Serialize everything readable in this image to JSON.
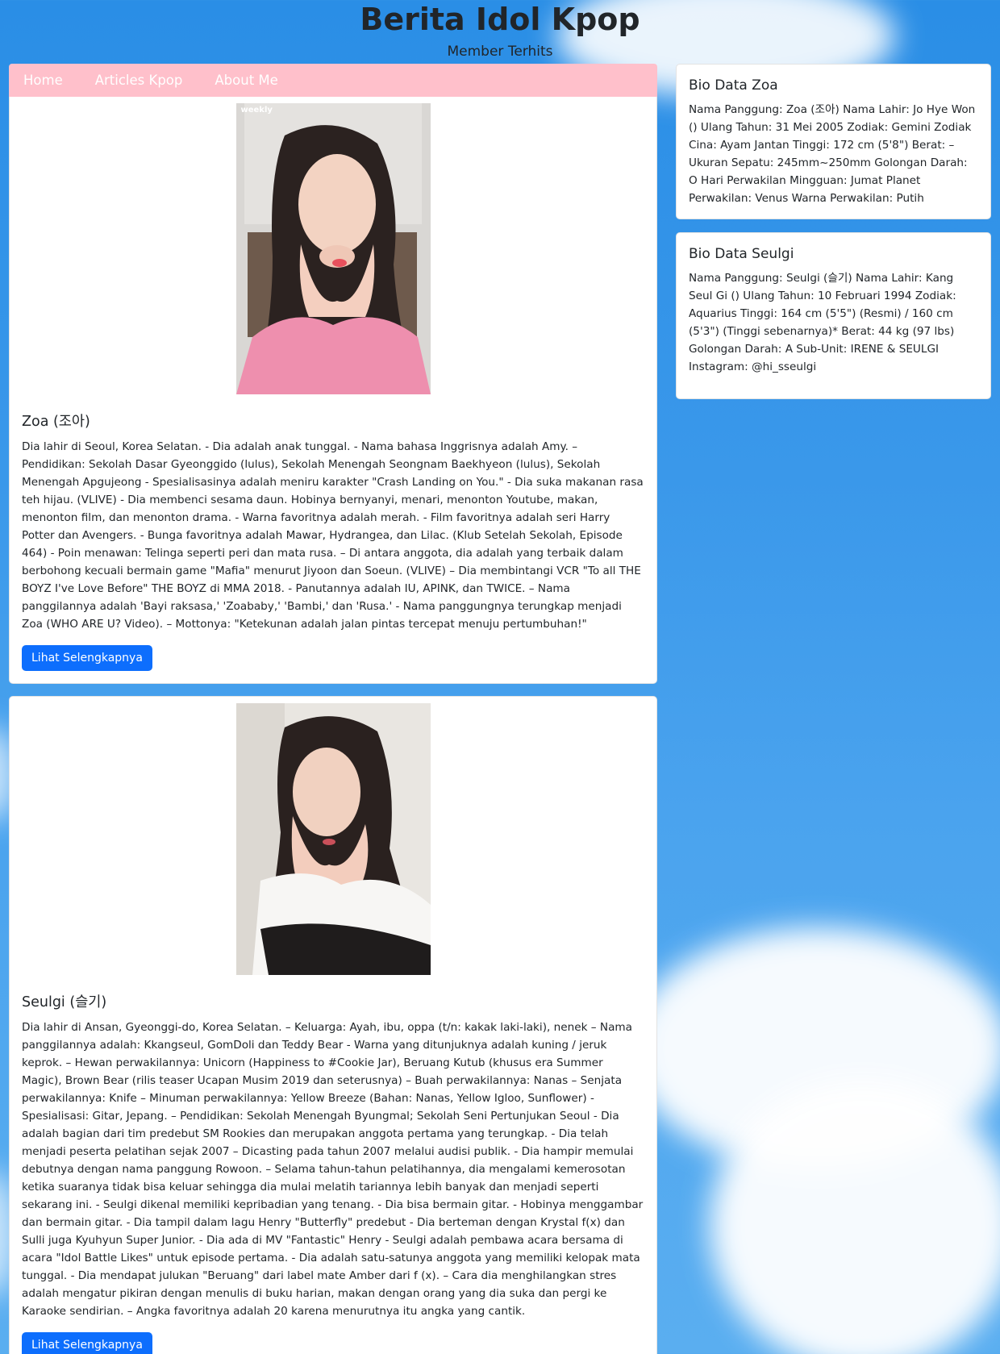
{
  "header": {
    "title": "Berita Idol Kpop",
    "subtitle": "Member Terhits"
  },
  "nav": {
    "items": [
      {
        "label": "Home"
      },
      {
        "label": "Articles Kpop"
      },
      {
        "label": "About Me"
      }
    ]
  },
  "articles": [
    {
      "photo_watermark": "weekly",
      "title": "Zoa (조아)",
      "body": "Dia lahir di Seoul, Korea Selatan. - Dia adalah anak tunggal. - Nama bahasa Inggrisnya adalah Amy. – Pendidikan: Sekolah Dasar Gyeonggido (lulus), Sekolah Menengah Seongnam Baekhyeon (lulus), Sekolah Menengah Apgujeong - Spesialisasinya adalah meniru karakter \"Crash Landing on You.\" - Dia suka makanan rasa teh hijau. (VLIVE) - Dia membenci sesama daun. Hobinya bernyanyi, menari, menonton Youtube, makan, menonton film, dan menonton drama. - Warna favoritnya adalah merah. - Film favoritnya adalah seri Harry Potter dan Avengers. - Bunga favoritnya adalah Mawar, Hydrangea, dan Lilac. (Klub Setelah Sekolah, Episode 464) - Poin menawan: Telinga seperti peri dan mata rusa. – Di antara anggota, dia adalah yang terbaik dalam berbohong kecuali bermain game \"Mafia\" menurut Jiyoon dan Soeun. (VLIVE) – Dia membintangi VCR \"To all THE BOYZ I've Love Before\" THE BOYZ di MMA 2018. - Panutannya adalah IU, APINK, dan TWICE. – Nama panggilannya adalah 'Bayi raksasa,' 'Zoababy,' 'Bambi,' dan 'Rusa.' - Nama panggungnya terungkap menjadi Zoa (WHO ARE U? Video). – Mottonya: \"Ketekunan adalah jalan pintas tercepat menuju pertumbuhan!\"",
      "button": "Lihat Selengkapnya"
    },
    {
      "photo_watermark": "",
      "title": "Seulgi (슬기)",
      "body": "Dia lahir di Ansan, Gyeonggi-do, Korea Selatan. – Keluarga: Ayah, ibu, oppa (t/n: kakak laki-laki), nenek – Nama panggilannya adalah: Kkangseul, GomDoli dan Teddy Bear - Warna yang ditunjuknya adalah kuning / jeruk keprok. – Hewan perwakilannya: Unicorn (Happiness to #Cookie Jar), Beruang Kutub (khusus era Summer Magic), Brown Bear (rilis teaser Ucapan Musim 2019 dan seterusnya) – Buah perwakilannya: Nanas – Senjata perwakilannya: Knife – Minuman perwakilannya: Yellow Breeze (Bahan: Nanas, Yellow Igloo, Sunflower) - Spesialisasi: Gitar, Jepang. – Pendidikan: Sekolah Menengah Byungmal; Sekolah Seni Pertunjukan Seoul - Dia adalah bagian dari tim predebut SM Rookies dan merupakan anggota pertama yang terungkap. - Dia telah menjadi peserta pelatihan sejak 2007 – Dicasting pada tahun 2007 melalui audisi publik. - Dia hampir memulai debutnya dengan nama panggung Rowoon. – Selama tahun-tahun pelatihannya, dia mengalami kemerosotan ketika suaranya tidak bisa keluar sehingga dia mulai melatih tariannya lebih banyak dan menjadi seperti sekarang ini. - Seulgi dikenal memiliki kepribadian yang tenang. - Dia bisa bermain gitar. - Hobinya menggambar dan bermain gitar. - Dia tampil dalam lagu Henry \"Butterfly\" predebut - Dia berteman dengan Krystal f(x) dan Sulli juga Kyuhyun Super Junior. - Dia ada di MV \"Fantastic\" Henry - Seulgi adalah pembawa acara bersama di acara \"Idol Battle Likes\" untuk episode pertama. - Dia adalah satu-satunya anggota yang memiliki kelopak mata tunggal. - Dia mendapat julukan \"Beruang\" dari label mate Amber dari f (x). – Cara dia menghilangkan stres adalah mengatur pikiran dengan menulis di buku harian, makan dengan orang yang dia suka dan pergi ke Karaoke sendirian. – Angka favoritnya adalah 20 karena menurutnya itu angka yang cantik.",
      "button": "Lihat Selengkapnya"
    }
  ],
  "sidebar": [
    {
      "title": "Bio Data Zoa",
      "body": "Nama Panggung: Zoa (조아) Nama Lahir: Jo Hye Won () Ulang Tahun: 31 Mei 2005 Zodiak: Gemini Zodiak Cina: Ayam Jantan Tinggi: 172 cm (5'8\") Berat: – Ukuran Sepatu: 245mm~250mm Golongan Darah: O Hari Perwakilan Mingguan: Jumat Planet Perwakilan: Venus Warna Perwakilan: Putih"
    },
    {
      "title": "Bio Data Seulgi",
      "body": "Nama Panggung: Seulgi (슬기) Nama Lahir: Kang Seul Gi () Ulang Tahun: 10 Februari 1994 Zodiak: Aquarius Tinggi: 164 cm (5'5\") (Resmi) / 160 cm (5'3\") (Tinggi sebenarnya)* Berat: 44 kg (97 lbs) Golongan Darah: A Sub-Unit: IRENE & SEULGI Instagram: @hi_sseulgi"
    }
  ]
}
